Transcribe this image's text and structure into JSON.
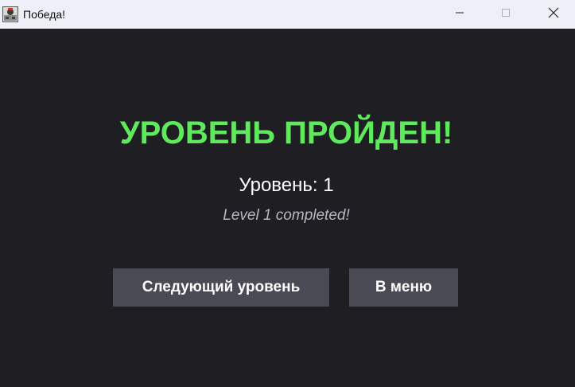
{
  "window": {
    "title": "Победа!",
    "background": "#1f1e23",
    "titlebar_background": "#eef0f8"
  },
  "icons": {
    "app": "app-icon",
    "minimize": "minimize-icon",
    "maximize": "maximize-icon",
    "close": "close-icon"
  },
  "main": {
    "headline": "УРОВЕНЬ ПРОЙДЕН!",
    "level_text": "Уровень: 1",
    "completed_text": "Level 1 completed!"
  },
  "buttons": {
    "next_label": "Следующий уровень",
    "menu_label": "В меню"
  },
  "colors": {
    "headline": "#5eea5c",
    "text": "#ffffff",
    "subtext": "#b8b8c0",
    "button_bg": "#4a4a55",
    "button_text": "#ffffff"
  }
}
